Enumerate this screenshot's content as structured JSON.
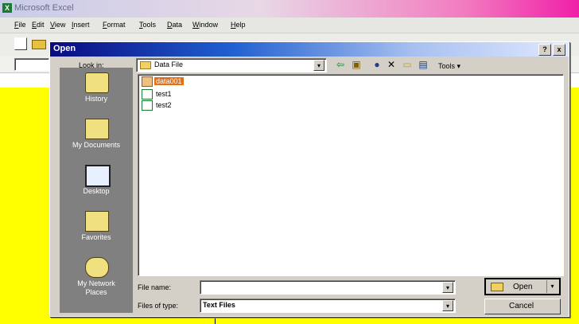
{
  "excel": {
    "title": "Microsoft Excel",
    "menu": [
      "File",
      "Edit",
      "View",
      "Insert",
      "Format",
      "Tools",
      "Data",
      "Window",
      "Help"
    ],
    "accent_color": "#f020a8",
    "sheet_color": "#ffff00"
  },
  "dialog": {
    "title": "Open",
    "help_btn": "?",
    "close_btn": "x",
    "look_in_label": "Look in:",
    "look_in_value": "Data File",
    "tools_label": "Tools",
    "places": [
      {
        "label": "History",
        "icon": "history-icon"
      },
      {
        "label": "My Documents",
        "icon": "my-documents-icon"
      },
      {
        "label": "Desktop",
        "icon": "desktop-icon"
      },
      {
        "label": "Favorites",
        "icon": "favorites-icon"
      },
      {
        "label": "My Network Places",
        "icon": "network-places-icon"
      }
    ],
    "files": [
      {
        "name": "data001",
        "selected": true
      },
      {
        "name": "test1",
        "selected": false
      },
      {
        "name": "test2",
        "selected": false
      }
    ],
    "file_name_label": "File name:",
    "file_name_value": "",
    "file_type_label": "Files of type:",
    "file_type_value": "Text Files",
    "open_button": "Open",
    "cancel_button": "Cancel",
    "selection_color": "#e0701c"
  }
}
